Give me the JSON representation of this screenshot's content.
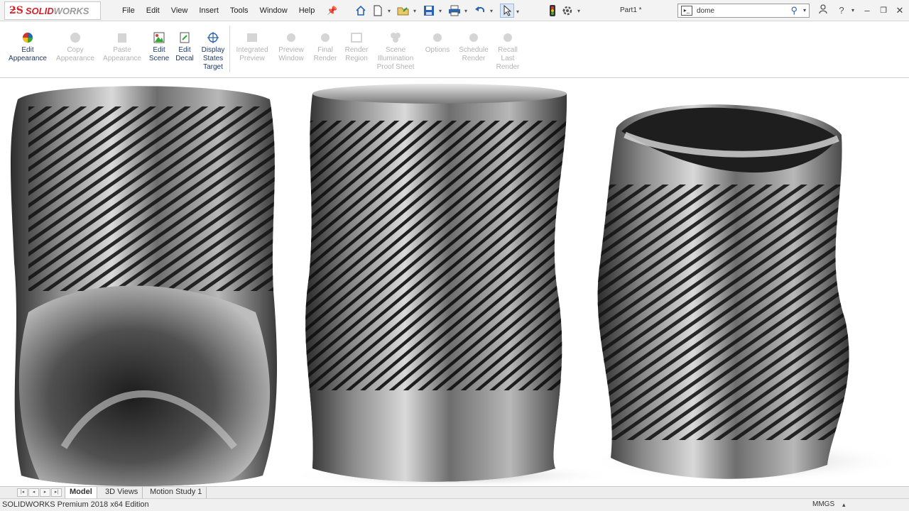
{
  "app": {
    "brand_prefix": "SOLID",
    "brand_suffix": "WORKS",
    "document_title": "Part1 *"
  },
  "menu": [
    "File",
    "Edit",
    "View",
    "Insert",
    "Tools",
    "Window",
    "Help"
  ],
  "quick_access_icons": [
    "home-icon",
    "new-document-icon",
    "open-icon",
    "save-icon",
    "print-icon",
    "undo-icon",
    "select-icon",
    "rebuild-icon",
    "options-icon"
  ],
  "search": {
    "value": "dome"
  },
  "ribbon": {
    "tools": [
      {
        "label": "Edit\nAppearance",
        "enabled": true
      },
      {
        "label": "Copy\nAppearance",
        "enabled": false
      },
      {
        "label": "Paste\nAppearance",
        "enabled": false
      },
      {
        "label": "Edit\nScene",
        "enabled": true
      },
      {
        "label": "Edit\nDecal",
        "enabled": true
      },
      {
        "label": "Display\nStates\nTarget",
        "enabled": true
      },
      {
        "label": "Integrated\nPreview",
        "enabled": false
      },
      {
        "label": "Preview\nWindow",
        "enabled": false
      },
      {
        "label": "Final\nRender",
        "enabled": false
      },
      {
        "label": "Render\nRegion",
        "enabled": false
      },
      {
        "label": "Scene\nIllumination\nProof Sheet",
        "enabled": false
      },
      {
        "label": "Options",
        "enabled": false
      },
      {
        "label": "Schedule\nRender",
        "enabled": false
      },
      {
        "label": "Recall\nLast\nRender",
        "enabled": false
      }
    ]
  },
  "tabs": [
    {
      "label": "Model",
      "active": true
    },
    {
      "label": "3D Views",
      "active": false
    },
    {
      "label": "Motion Study 1",
      "active": false
    }
  ],
  "status": {
    "edition": "SOLIDWORKS Premium 2018 x64 Edition",
    "units": "MMGS"
  },
  "colors": {
    "brand_red": "#d2232a",
    "accent_blue": "#2a63b0"
  }
}
